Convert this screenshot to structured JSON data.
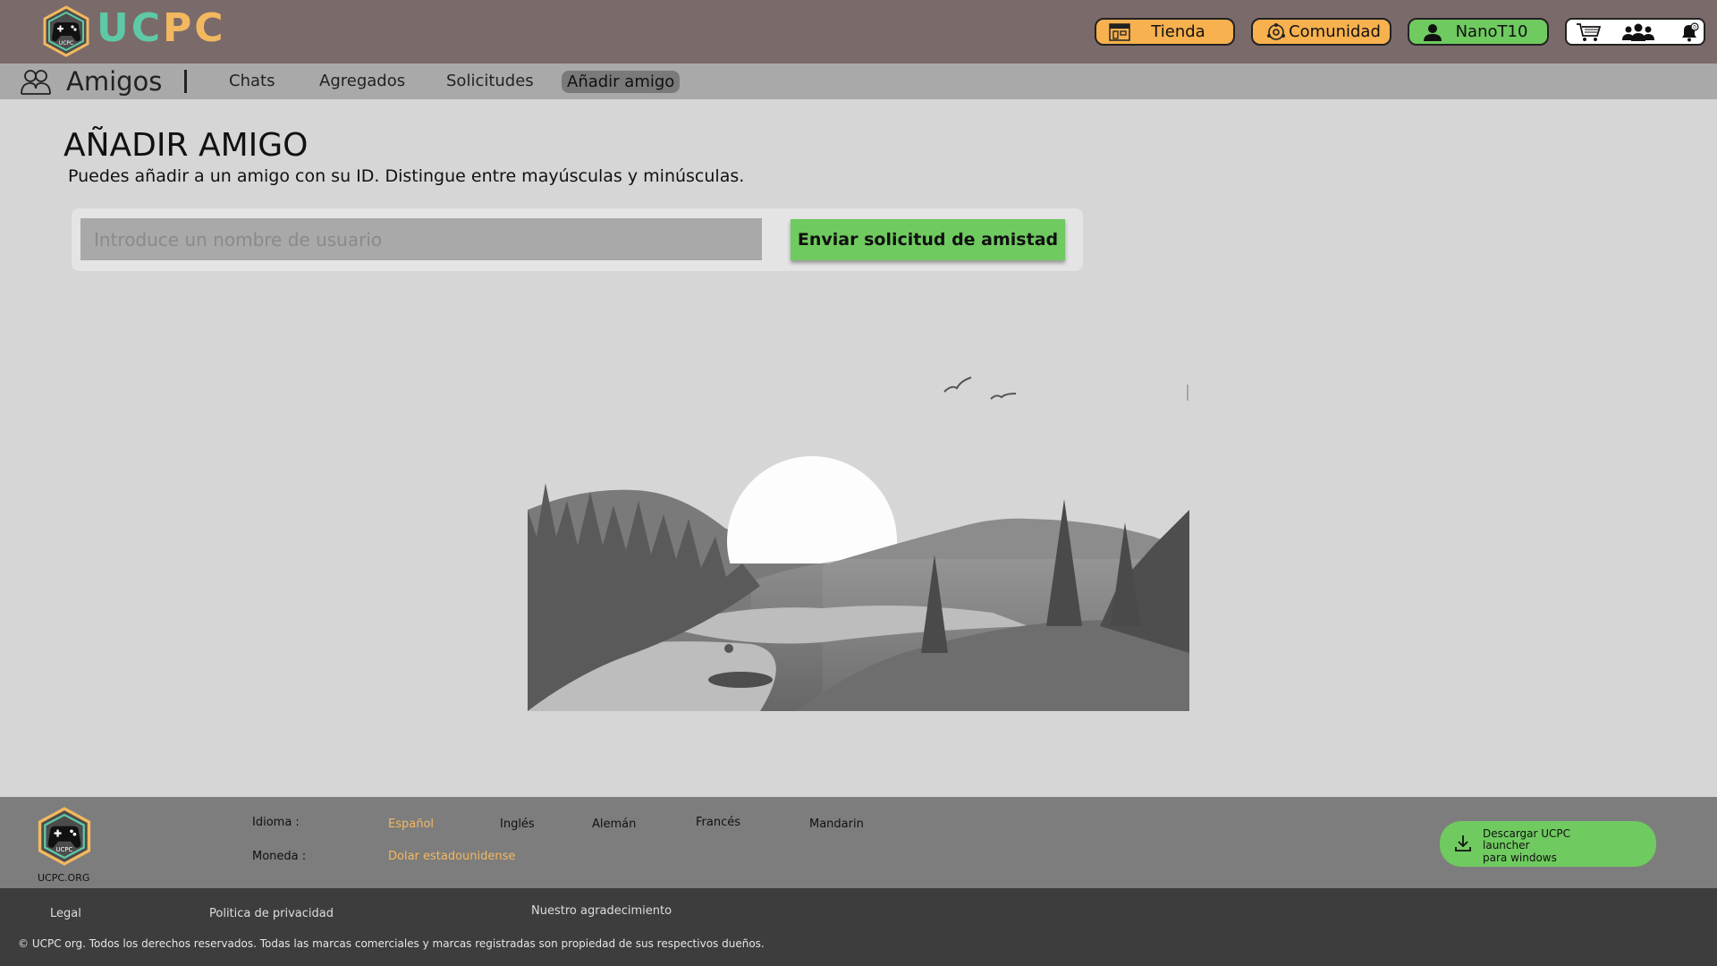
{
  "header": {
    "brand": "UCPC",
    "nav": {
      "store_label": "Tienda",
      "community_label": "Comunidad",
      "user_label": "NanoT10"
    }
  },
  "subnav": {
    "section_title": "Amigos",
    "tabs": [
      {
        "label": "Chats",
        "active": false
      },
      {
        "label": "Agregados",
        "active": false
      },
      {
        "label": "Solicitudes",
        "active": false
      },
      {
        "label": "Añadir amigo",
        "active": true
      }
    ]
  },
  "main": {
    "title": "AÑADIR AMIGO",
    "description": "Puedes añadir a un amigo con su ID. Distingue entre mayúsculas y minúsculas.",
    "username_input": {
      "placeholder": "Introduce un nombre de usuario",
      "value": ""
    },
    "send_button": "Enviar solicitud de amistad"
  },
  "footer": {
    "logo_label": "UCPC.ORG",
    "language_label": "Idioma :",
    "languages": [
      {
        "label": "Español",
        "selected": true
      },
      {
        "label": "Inglés",
        "selected": false
      },
      {
        "label": "Alemán",
        "selected": false
      },
      {
        "label": "Francés",
        "selected": false
      },
      {
        "label": "Mandarin",
        "selected": false
      }
    ],
    "currency_label": "Moneda :",
    "currency_value": "Dolar estadounidense",
    "download": {
      "line1": "Descargar UCPC launcher",
      "line2": "para windows"
    },
    "links": {
      "legal": "Legal",
      "privacy": "Politica de privacidad",
      "thanks": "Nuestro agradecimiento"
    },
    "copyright": "© UCPC org. Todos los derechos reservados. Todas las marcas comerciales y marcas registradas son propiedad de sus respectivos dueños."
  },
  "colors": {
    "header_bg": "#7b6a6a",
    "accent_orange": "#f7b14f",
    "accent_green": "#6fca60",
    "brand_teal": "#5ec9a6"
  },
  "icons": [
    "gamepad-logo-icon",
    "store-icon",
    "community-icon",
    "user-icon",
    "cart-icon",
    "friends-icon",
    "notifications-icon",
    "download-icon"
  ]
}
